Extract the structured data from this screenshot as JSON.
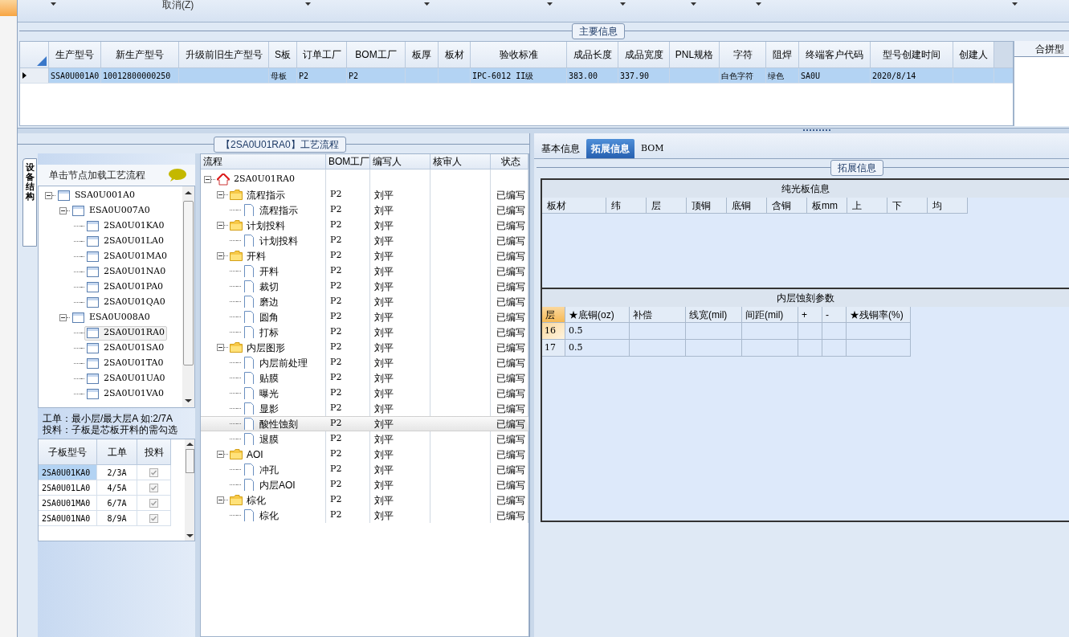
{
  "toolbar": {
    "cancel_label": "取消(Z)"
  },
  "main_info": {
    "title": "主要信息",
    "columns": [
      "生产型号",
      "新生产型号",
      "升级前旧生产型号",
      "S板",
      "订单工厂",
      "BOM工厂",
      "板厚",
      "板材",
      "验收标准",
      "成品长度",
      "成品宽度",
      "PNL规格",
      "字符",
      "阻焊",
      "终端客户代码",
      "型号创建时间",
      "创建人"
    ],
    "rows": [
      {
        "selected": true,
        "cells": [
          "SSA0U001A0",
          "10012800000250",
          null,
          "母板",
          "P2",
          "P2",
          null,
          null,
          "IPC-6012 II级",
          "383.00",
          "337.90",
          null,
          "白色字符",
          "绿色",
          "SA0U",
          "2020/8/14",
          null
        ]
      }
    ]
  },
  "merge_panel": {
    "title": "合拼型"
  },
  "flow_panel": {
    "title": "【2SA0U01RA0】工艺流程",
    "side_tab": "设备结构",
    "hint_header": "单击节点加载工艺流程",
    "structure_tree": [
      {
        "name": "SSA0U001A0",
        "expanded": true,
        "selected": false,
        "children": [
          {
            "name": "ESA0U007A0",
            "expanded": true,
            "selected": false,
            "children": [
              {
                "name": "2SA0U01KA0",
                "selected": false
              },
              {
                "name": "2SA0U01LA0",
                "selected": false
              },
              {
                "name": "2SA0U01MA0",
                "selected": false
              },
              {
                "name": "2SA0U01NA0",
                "selected": false
              },
              {
                "name": "2SA0U01PA0",
                "selected": false
              },
              {
                "name": "2SA0U01QA0",
                "selected": false
              }
            ]
          },
          {
            "name": "ESA0U008A0",
            "expanded": true,
            "selected": false,
            "children": [
              {
                "name": "2SA0U01RA0",
                "selected": true
              },
              {
                "name": "2SA0U01SA0",
                "selected": false
              },
              {
                "name": "2SA0U01TA0",
                "selected": false
              },
              {
                "name": "2SA0U01UA0",
                "selected": false
              },
              {
                "name": "2SA0U01VA0",
                "selected": false
              }
            ]
          }
        ]
      }
    ],
    "note_lines": [
      "工单：最小层/最大层A 如:2/7A",
      "投料：子板是芯板开料的需勾选"
    ],
    "subboards": {
      "columns": [
        "子板型号",
        "工单",
        "投料"
      ],
      "rows": [
        {
          "model": "2SA0U01KA0",
          "order": "2/3A",
          "checked": true,
          "selected": true
        },
        {
          "model": "2SA0U01LA0",
          "order": "4/5A",
          "checked": true,
          "selected": false
        },
        {
          "model": "2SA0U01MA0",
          "order": "6/7A",
          "checked": true,
          "selected": false
        },
        {
          "model": "2SA0U01NA0",
          "order": "8/9A",
          "checked": true,
          "selected": false
        }
      ]
    },
    "flow": {
      "columns": [
        "流程",
        "BOM工厂",
        "编写人",
        "核审人",
        "状态"
      ],
      "tree": [
        {
          "name": "2SA0U01RA0",
          "kind": "root",
          "expanded": true,
          "selected": false,
          "children": [
            {
              "name": "流程指示",
              "kind": "folder",
              "factory": "P2",
              "author": "刘平",
              "status": "已编写",
              "expanded": true,
              "selected": false,
              "children": [
                {
                  "name": "流程指示",
                  "kind": "step",
                  "factory": "P2",
                  "author": "刘平",
                  "status": "已编写",
                  "selected": false
                }
              ]
            },
            {
              "name": "计划投料",
              "kind": "folder",
              "factory": "P2",
              "author": "刘平",
              "status": "已编写",
              "expanded": true,
              "selected": false,
              "children": [
                {
                  "name": "计划投料",
                  "kind": "step",
                  "factory": "P2",
                  "author": "刘平",
                  "status": "已编写",
                  "selected": false
                }
              ]
            },
            {
              "name": "开料",
              "kind": "folder",
              "factory": "P2",
              "author": "刘平",
              "status": "已编写",
              "expanded": true,
              "selected": false,
              "children": [
                {
                  "name": "开料",
                  "kind": "step",
                  "factory": "P2",
                  "author": "刘平",
                  "status": "已编写",
                  "selected": false
                },
                {
                  "name": "裁切",
                  "kind": "step",
                  "factory": "P2",
                  "author": "刘平",
                  "status": "已编写",
                  "selected": false
                },
                {
                  "name": "磨边",
                  "kind": "step",
                  "factory": "P2",
                  "author": "刘平",
                  "status": "已编写",
                  "selected": false
                },
                {
                  "name": "圆角",
                  "kind": "step",
                  "factory": "P2",
                  "author": "刘平",
                  "status": "已编写",
                  "selected": false
                },
                {
                  "name": "打标",
                  "kind": "step",
                  "factory": "P2",
                  "author": "刘平",
                  "status": "已编写",
                  "selected": false
                }
              ]
            },
            {
              "name": "内层图形",
              "kind": "folder",
              "factory": "P2",
              "author": "刘平",
              "status": "已编写",
              "expanded": true,
              "selected": false,
              "children": [
                {
                  "name": "内层前处理",
                  "kind": "step",
                  "factory": "P2",
                  "author": "刘平",
                  "status": "已编写",
                  "selected": false
                },
                {
                  "name": "贴膜",
                  "kind": "step",
                  "factory": "P2",
                  "author": "刘平",
                  "status": "已编写",
                  "selected": false
                },
                {
                  "name": "曝光",
                  "kind": "step",
                  "factory": "P2",
                  "author": "刘平",
                  "status": "已编写",
                  "selected": false
                },
                {
                  "name": "显影",
                  "kind": "step",
                  "factory": "P2",
                  "author": "刘平",
                  "status": "已编写",
                  "selected": false
                },
                {
                  "name": "酸性蚀刻",
                  "kind": "step",
                  "factory": "P2",
                  "author": "刘平",
                  "status": "已编写",
                  "selected": true
                },
                {
                  "name": "退膜",
                  "kind": "step",
                  "factory": "P2",
                  "author": "刘平",
                  "status": "已编写",
                  "selected": false
                }
              ]
            },
            {
              "name": "AOI",
              "kind": "folder",
              "factory": "P2",
              "author": "刘平",
              "status": "已编写",
              "expanded": true,
              "selected": false,
              "children": [
                {
                  "name": "冲孔",
                  "kind": "step",
                  "factory": "P2",
                  "author": "刘平",
                  "status": "已编写",
                  "selected": false
                },
                {
                  "name": "内层AOI",
                  "kind": "step",
                  "factory": "P2",
                  "author": "刘平",
                  "status": "已编写",
                  "selected": false
                }
              ]
            },
            {
              "name": "棕化",
              "kind": "folder",
              "factory": "P2",
              "author": "刘平",
              "status": "已编写",
              "expanded": true,
              "selected": false,
              "children": [
                {
                  "name": "棕化",
                  "kind": "step",
                  "factory": "P2",
                  "author": "刘平",
                  "status": "已编写",
                  "selected": false
                }
              ]
            }
          ]
        }
      ]
    }
  },
  "details": {
    "tabs": [
      {
        "label": "基本信息",
        "selected": false
      },
      {
        "label": "拓展信息",
        "selected": true
      },
      {
        "label": "BOM",
        "selected": false
      }
    ],
    "group_title": "拓展信息",
    "bare_board": {
      "title": "纯光板信息",
      "columns": [
        "板材",
        "纬",
        "层",
        "顶铜",
        "底铜",
        "含铜",
        "板mm",
        "上",
        "下",
        "均"
      ]
    },
    "etch": {
      "title": "内层蚀刻参数",
      "columns": [
        "层",
        "★底铜(oz)",
        "补偿",
        "线宽(mil)",
        "间距(mil)",
        "+",
        "-",
        "★残铜率(%)"
      ],
      "rows": [
        {
          "layer": "16",
          "base_copper": "0.5",
          "selected": true
        },
        {
          "layer": "17",
          "base_copper": "0.5",
          "selected": false
        }
      ]
    }
  }
}
